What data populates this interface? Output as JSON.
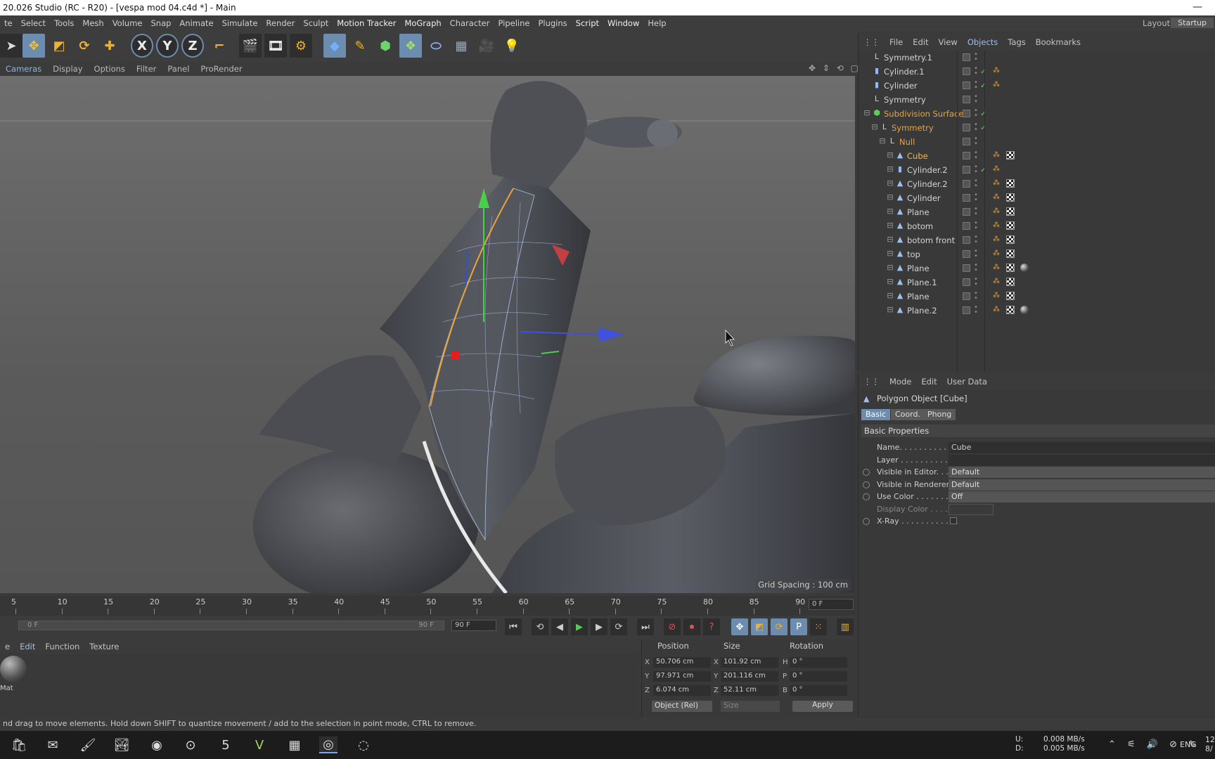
{
  "window": {
    "title": "20.026 Studio (RC - R20) - [vespa mod 04.c4d *] - Main"
  },
  "menubar": {
    "items": [
      "te",
      "Select",
      "Tools",
      "Mesh",
      "Volume",
      "Snap",
      "Animate",
      "Simulate",
      "Render",
      "Sculpt",
      "Motion Tracker",
      "MoGraph",
      "Character",
      "Pipeline",
      "Plugins",
      "Script",
      "Window",
      "Help"
    ],
    "layout_label": "Layout:",
    "layout_value": "Startup"
  },
  "toolbar": {
    "icons": [
      "live-selection-icon",
      "move-icon",
      "scale-icon",
      "rotate-icon",
      "add-icon",
      "x-axis-icon",
      "y-axis-icon",
      "z-axis-icon",
      "world-coords-icon",
      "render-view-icon",
      "render-picture-viewer-icon",
      "render-settings-icon",
      "cube-icon",
      "pen-icon",
      "subdivision-icon",
      "array-icon",
      "deformer-icon",
      "floor-icon",
      "camera-icon",
      "light-icon"
    ],
    "axis_labels": [
      "X",
      "Y",
      "Z"
    ]
  },
  "viewport": {
    "menu": [
      "Cameras",
      "Display",
      "Options",
      "Filter",
      "Panel",
      "ProRender"
    ],
    "grid_spacing": "Grid Spacing : 100 cm",
    "nav_icons": "✥ ⇕ ⟲ ▢"
  },
  "object_manager": {
    "menu": [
      "File",
      "Edit",
      "View",
      "Objects",
      "Tags",
      "Bookmarks"
    ],
    "rows": [
      {
        "name": "Symmetry.1",
        "indent": 0,
        "icon": "symmetry-icon",
        "style": "normal",
        "check": false,
        "tags": []
      },
      {
        "name": "Cylinder.1",
        "indent": 0,
        "icon": "cylinder-icon",
        "style": "normal",
        "check": true,
        "tags": [
          "phong"
        ]
      },
      {
        "name": "Cylinder",
        "indent": 0,
        "icon": "cylinder-icon",
        "style": "normal",
        "check": true,
        "tags": [
          "phong"
        ]
      },
      {
        "name": "Symmetry",
        "indent": 0,
        "icon": "symmetry-icon",
        "style": "normal",
        "check": false,
        "tags": []
      },
      {
        "name": "Subdivision Surface",
        "indent": 0,
        "icon": "subdivision-icon",
        "style": "orange",
        "check": true,
        "tags": []
      },
      {
        "name": "Symmetry",
        "indent": 1,
        "icon": "symmetry-icon",
        "style": "orange",
        "check": true,
        "tags": []
      },
      {
        "name": "Null",
        "indent": 2,
        "icon": "null-icon",
        "style": "orange",
        "check": false,
        "tags": []
      },
      {
        "name": "Cube",
        "indent": 3,
        "icon": "polygon-icon",
        "style": "sel",
        "check": false,
        "tags": [
          "phong",
          "tex"
        ]
      },
      {
        "name": "Cylinder.2",
        "indent": 3,
        "icon": "cylinder-icon",
        "style": "normal",
        "check": true,
        "tags": [
          "phong"
        ]
      },
      {
        "name": "Cylinder.2",
        "indent": 3,
        "icon": "polygon-icon",
        "style": "normal",
        "check": false,
        "tags": [
          "phong",
          "tex"
        ]
      },
      {
        "name": "Cylinder",
        "indent": 3,
        "icon": "polygon-icon",
        "style": "normal",
        "check": false,
        "tags": [
          "phong",
          "tex"
        ]
      },
      {
        "name": "Plane",
        "indent": 3,
        "icon": "polygon-icon",
        "style": "normal",
        "check": false,
        "tags": [
          "phong",
          "tex"
        ]
      },
      {
        "name": "botom",
        "indent": 3,
        "icon": "polygon-icon",
        "style": "normal",
        "check": false,
        "tags": [
          "phong",
          "tex"
        ]
      },
      {
        "name": "botom front",
        "indent": 3,
        "icon": "polygon-icon",
        "style": "normal",
        "check": false,
        "tags": [
          "phong",
          "tex"
        ]
      },
      {
        "name": "top",
        "indent": 3,
        "icon": "polygon-icon",
        "style": "normal",
        "check": false,
        "tags": [
          "phong",
          "tex"
        ]
      },
      {
        "name": "Plane",
        "indent": 3,
        "icon": "polygon-icon",
        "style": "normal",
        "check": false,
        "tags": [
          "phong",
          "tex",
          "mat"
        ]
      },
      {
        "name": "Plane.1",
        "indent": 3,
        "icon": "polygon-icon",
        "style": "normal",
        "check": false,
        "tags": [
          "phong",
          "tex"
        ]
      },
      {
        "name": "Plane",
        "indent": 3,
        "icon": "polygon-icon",
        "style": "normal",
        "check": false,
        "tags": [
          "phong",
          "tex"
        ]
      },
      {
        "name": "Plane.2",
        "indent": 3,
        "icon": "polygon-icon",
        "style": "normal",
        "check": false,
        "tags": [
          "phong",
          "tex",
          "mat"
        ]
      }
    ]
  },
  "attribute_manager": {
    "menu": [
      "Mode",
      "Edit",
      "User Data"
    ],
    "title": "Polygon Object [Cube]",
    "tabs": [
      "Basic",
      "Coord.",
      "Phong"
    ],
    "active_tab": "Basic",
    "section": "Basic Properties",
    "fields": [
      {
        "label": "Name. . . . . . . . . . . . .",
        "value": "Cube",
        "type": "text",
        "radio": false
      },
      {
        "label": "Layer . . . . . . . . . . . . .",
        "value": "",
        "type": "text",
        "radio": false
      },
      {
        "label": "Visible in Editor. . .",
        "value": "Default",
        "type": "dropdown",
        "radio": true
      },
      {
        "label": "Visible in Renderer",
        "value": "Default",
        "type": "dropdown",
        "radio": true
      },
      {
        "label": "Use Color . . . . . . . .",
        "value": "Off",
        "type": "dropdown",
        "radio": true
      },
      {
        "label": "Display Color . . . .",
        "value": "",
        "type": "color",
        "radio": false
      },
      {
        "label": "X-Ray . . . . . . . . . . . .",
        "value": "",
        "type": "checkbox",
        "radio": true
      }
    ]
  },
  "timeline": {
    "ticks": [
      "5",
      "10",
      "15",
      "20",
      "25",
      "30",
      "35",
      "40",
      "45",
      "50",
      "55",
      "60",
      "65",
      "70",
      "75",
      "80",
      "85",
      "90"
    ],
    "current_frame": "0 F",
    "range_start": "0 F",
    "range_end": "90 F",
    "end_frame": "90 F"
  },
  "material_manager": {
    "menu": [
      "e",
      "Edit",
      "Function",
      "Texture"
    ],
    "material_name": "Mat"
  },
  "coordinates": {
    "headers": [
      "Position",
      "Size",
      "Rotation"
    ],
    "position": {
      "x": "50.706 cm",
      "y": "97.971 cm",
      "z": "6.074 cm"
    },
    "size": {
      "x": "101.92 cm",
      "y": "201.116 cm",
      "z": "52.11 cm"
    },
    "rotation": {
      "h": "0 °",
      "p": "0 °",
      "b": "0 °"
    },
    "mode": "Object (Rel)",
    "size_mode": "Size",
    "apply_label": "Apply"
  },
  "statusbar": {
    "text": "nd drag to move elements. Hold down SHIFT to quantize movement / add to the selection in point mode, CTRL to remove."
  },
  "taskbar": {
    "icons": [
      "store-icon",
      "mail-icon",
      "paint-icon",
      "photos-icon",
      "chrome-icon",
      "obs-icon",
      "five-icon",
      "vegas-icon",
      "calculator-icon",
      "cinema4d-icon",
      "blender-like-icon"
    ],
    "net_up_label": "U:",
    "net_down_label": "D:",
    "net_up": "0.008 MB/s",
    "net_down": "0.005 MB/s",
    "tray_glyphs": "⌃ ⚟ 🔊 ⊘ ✎",
    "lang": "ENG",
    "clock_top": "12",
    "clock_bottom": "8/"
  },
  "colors": {
    "accent_blue": "#6c8cb0",
    "orange_object": "#e8a53a",
    "selected_object": "#f5b942",
    "check_green": "#5ccf5c"
  }
}
